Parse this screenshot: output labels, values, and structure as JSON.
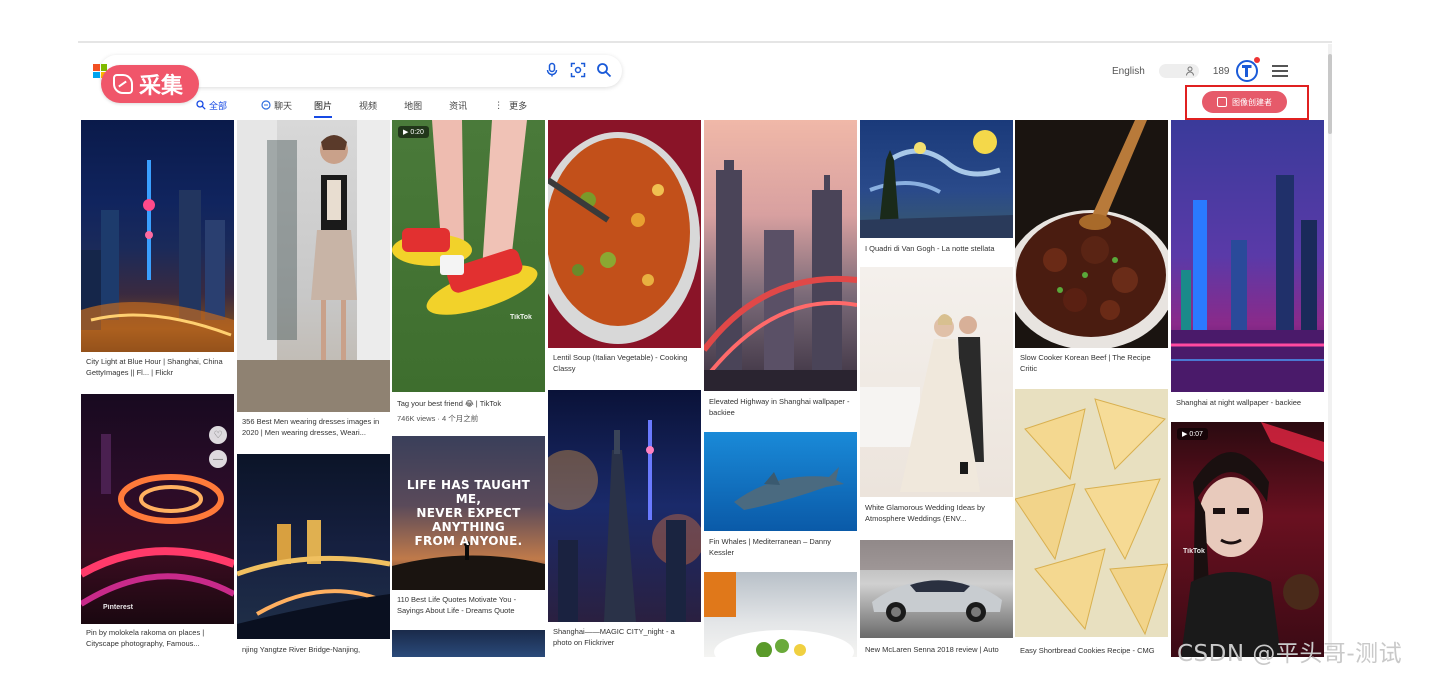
{
  "collector": {
    "label": "采集"
  },
  "search": {
    "placeholder": ""
  },
  "tabs": [
    {
      "label": "全部",
      "icon": "search-icon"
    },
    {
      "label": "聊天",
      "icon": "chat-icon"
    },
    {
      "label": "图片",
      "icon": ""
    },
    {
      "label": "视频",
      "icon": ""
    },
    {
      "label": "地图",
      "icon": ""
    },
    {
      "label": "资讯",
      "icon": ""
    },
    {
      "label": "更多",
      "icon": "more-icon"
    }
  ],
  "header": {
    "language": "English",
    "points": "189"
  },
  "create_button": {
    "label": "图像创建者"
  },
  "cards": {
    "c1": {
      "caption": "City Light at Blue Hour | Shanghai, China GettyImages || Fl... | Flickr"
    },
    "c2": {
      "caption": "Pin by molokela rakoma on places | Cityscape photography, Famous..."
    },
    "c2_watermark": "Pinterest",
    "c3": {
      "caption": "356 Best Men wearing dresses images in 2020 | Men wearing dresses, Weari..."
    },
    "c4": {
      "caption": "njing Yangtze River Bridge-Nanjing,"
    },
    "c5": {
      "caption": "Tag your best friend 😂 | TikTok",
      "meta": "746K views · 4 个月之前"
    },
    "c5_badge": "▶ 0:20",
    "c5_watermark": "TikTok",
    "c6": {
      "caption": "110 Best Life Quotes Motivate You - Sayings About Life - Dreams Quote"
    },
    "c6_quote": [
      "LIFE HAS TAUGHT ME,",
      "NEVER EXPECT ANYTHING",
      "FROM ANYONE."
    ],
    "c7": {
      "caption": "Lentil Soup (Italian Vegetable) - Cooking Classy"
    },
    "c8": {
      "caption": "Shanghai——MAGIC CITY_night - a photo on Flickriver"
    },
    "c9": {
      "caption": "Elevated Highway in Shanghai wallpaper - backiee"
    },
    "c10": {
      "caption": "Fin Whales | Mediterranean – Danny Kessler"
    },
    "c12": {
      "caption": "I Quadri di Van Gogh - La notte stellata"
    },
    "c13": {
      "caption": "White Glamorous Wedding Ideas by Atmosphere Weddings (ENV..."
    },
    "c14": {
      "caption": "New McLaren Senna 2018 review | Auto"
    },
    "c15": {
      "caption": "Slow Cooker Korean Beef | The Recipe Critic"
    },
    "c16": {
      "caption": "Easy Shortbread Cookies Recipe - CMG"
    },
    "c17": {
      "caption": "Shanghai at night wallpaper - backiee"
    },
    "c18_badge": "▶ 0:07",
    "c18_watermark": "TikTok"
  },
  "watermark": "CSDN @平头哥-测试",
  "colors": {
    "accent": "#f0566a",
    "tab_active": "#174ae4",
    "highlight_box": "#e02020"
  }
}
